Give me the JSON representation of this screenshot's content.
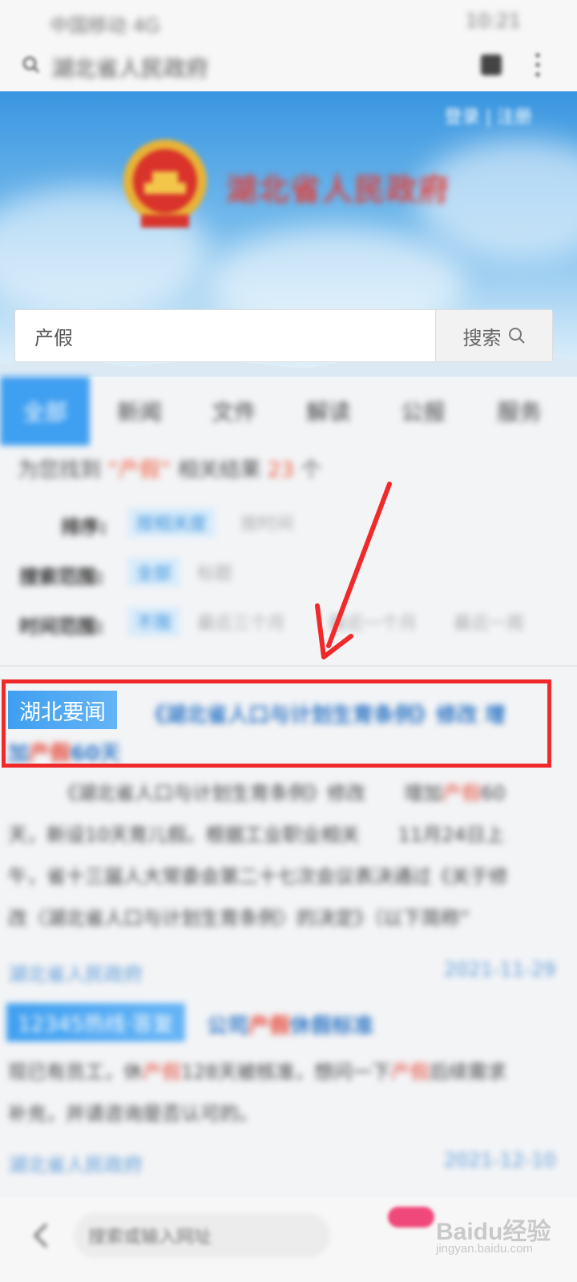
{
  "status_bar": {
    "left_text": "中国移动 4G",
    "right_text": "10:21"
  },
  "address_bar": {
    "query": "湖北省人民政府"
  },
  "banner": {
    "title": "湖北省人民政府",
    "login_text": "登录 | 注册"
  },
  "search": {
    "value": "产假",
    "button_label": "搜索"
  },
  "tabs": [
    {
      "label": "全部"
    },
    {
      "label": "新闻"
    },
    {
      "label": "文件"
    },
    {
      "label": "解读"
    },
    {
      "label": "公报"
    },
    {
      "label": "服务"
    }
  ],
  "result_summary": {
    "prefix": "为您找到",
    "keyword": "“产假”",
    "middle": "相关结果",
    "count": "23",
    "suffix": "个"
  },
  "filters": {
    "sort": {
      "label": "排序:",
      "options": [
        "按相关度",
        "按时间"
      ]
    },
    "scope": {
      "label": "搜索范围:",
      "options": [
        "全部",
        "标题"
      ]
    },
    "time": {
      "label": "时间范围:",
      "options": [
        "不限",
        "最近三个月",
        "最近一个月",
        "最近一周"
      ]
    }
  },
  "results": [
    {
      "tag": "湖北要闻",
      "title_a": "《湖北省人口与计划生育条例》修改 增",
      "title_b": "加",
      "title_hl": "产假",
      "title_c": "60天",
      "snippet_1a": "《湖北省人口与计划生育条例》修改　　增加",
      "snippet_1hl": "产假",
      "snippet_1b": "60",
      "snippet_2": "天，新设10天育儿假。根据工业职业相关　　11月24日上",
      "snippet_3": "午，省十三届人大常委会第二十七次会议表决通过《关于修",
      "snippet_4": "改〈湖北省人口与计划生育条例〉的决定》（以下简称“",
      "source": "湖北省人民政府",
      "date": "2021-11-29"
    },
    {
      "tag": "12345热线·答复",
      "title_a": "公司",
      "title_hl": "产假",
      "title_b": "休假标准",
      "snippet_1a": "现已有员工，休",
      "snippet_1hl": "产假",
      "snippet_1b": "128天被核准，想问一下",
      "snippet_1hl2": "产假",
      "snippet_1c": "后续需求",
      "snippet_2": "补充，并请咨询是否认可的。",
      "source": "湖北省人民政府",
      "date": "2021-12-10"
    }
  ],
  "bottom_bar": {
    "input_placeholder": "搜索或输入网址"
  },
  "watermark": {
    "main": "Baidu经验",
    "sub": "jingyan.baidu.com"
  },
  "colors": {
    "accent": "#3f9ff0",
    "highlight": "#e64a3b",
    "annotation": "#f02a2a"
  }
}
